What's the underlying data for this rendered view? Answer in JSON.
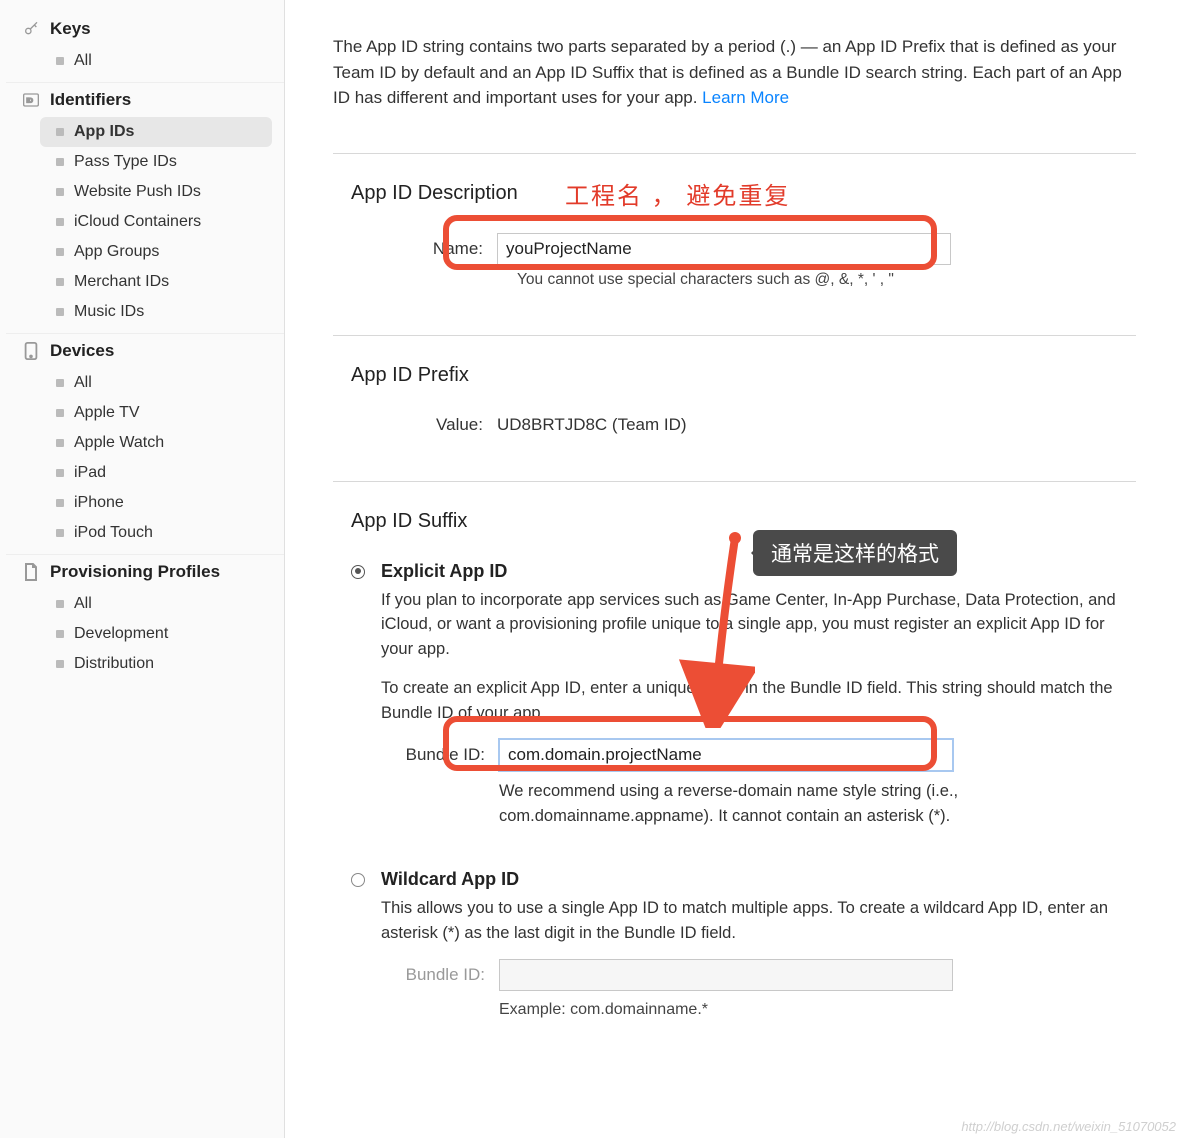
{
  "sidebar": {
    "groups": [
      {
        "title": "Keys",
        "icon": "key-icon",
        "items": [
          {
            "label": "All",
            "active": false
          }
        ]
      },
      {
        "title": "Identifiers",
        "icon": "id-icon",
        "items": [
          {
            "label": "App IDs",
            "active": true
          },
          {
            "label": "Pass Type IDs",
            "active": false
          },
          {
            "label": "Website Push IDs",
            "active": false
          },
          {
            "label": "iCloud Containers",
            "active": false
          },
          {
            "label": "App Groups",
            "active": false
          },
          {
            "label": "Merchant IDs",
            "active": false
          },
          {
            "label": "Music IDs",
            "active": false
          }
        ]
      },
      {
        "title": "Devices",
        "icon": "device-icon",
        "items": [
          {
            "label": "All",
            "active": false
          },
          {
            "label": "Apple TV",
            "active": false
          },
          {
            "label": "Apple Watch",
            "active": false
          },
          {
            "label": "iPad",
            "active": false
          },
          {
            "label": "iPhone",
            "active": false
          },
          {
            "label": "iPod Touch",
            "active": false
          }
        ]
      },
      {
        "title": "Provisioning Profiles",
        "icon": "profile-icon",
        "items": [
          {
            "label": "All",
            "active": false
          },
          {
            "label": "Development",
            "active": false
          },
          {
            "label": "Distribution",
            "active": false
          }
        ]
      }
    ]
  },
  "main": {
    "intro": "The App ID string contains two parts separated by a period (.) — an App ID Prefix that is defined as your Team ID by default and an App ID Suffix that is defined as a Bundle ID search string. Each part of an App ID has different and important uses for your app. ",
    "learn_more": "Learn More",
    "desc": {
      "title": "App ID Description",
      "name_label": "Name:",
      "name_value": "youProjectName",
      "hint": "You cannot use special characters such as @, &, *, ' , \""
    },
    "prefix": {
      "title": "App ID Prefix",
      "value_label": "Value:",
      "value": "UD8BRTJD8C (Team ID)"
    },
    "suffix": {
      "title": "App ID Suffix",
      "explicit": {
        "title": "Explicit App ID",
        "desc1": "If you plan to incorporate app services such as Game Center, In-App Purchase, Data Protection, and iCloud, or want a provisioning profile unique to a single app, you must register an explicit App ID for your app.",
        "desc2": "To create an explicit App ID, enter a unique string in the Bundle ID field. This string should match the Bundle ID of your app.",
        "bundle_label": "Bundle ID:",
        "bundle_value": "com.domain.projectName",
        "bundle_hint": "We recommend using a reverse-domain name style string (i.e., com.domainname.appname). It cannot contain an asterisk (*)."
      },
      "wildcard": {
        "title": "Wildcard App ID",
        "desc": "This allows you to use a single App ID to match multiple apps. To create a wildcard App ID, enter an asterisk (*) as the last digit in the Bundle ID field.",
        "bundle_label": "Bundle ID:",
        "bundle_value": "",
        "example_label": "Example: com.domainname.*"
      }
    }
  },
  "annotations": {
    "red_text": "工程名 ，  避免重复",
    "tooltip": "通常是这样的格式"
  },
  "watermark": "http://blog.csdn.net/weixin_51070052"
}
